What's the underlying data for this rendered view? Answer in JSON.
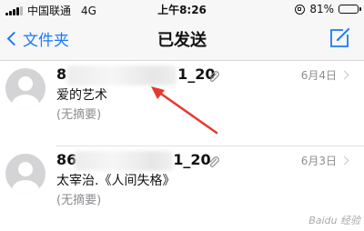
{
  "status_bar": {
    "carrier": "中国联通",
    "network": "4G",
    "time": "上午8:26",
    "battery_percent": "81%",
    "battery_level": 0.81
  },
  "nav": {
    "back_label": "文件夹",
    "title": "已发送"
  },
  "mails": [
    {
      "sender_visible": "8",
      "sender_suffix": "1_20",
      "date": "6月4日",
      "subject": "爱的艺术",
      "preview": "(无摘要)"
    },
    {
      "sender_visible": "86",
      "sender_suffix": "1_20",
      "date": "6月3日",
      "subject": "太宰治.《人间失格》",
      "preview": "(无摘要)"
    }
  ],
  "colors": {
    "accent": "#1a7af8",
    "arrow": "#e8382d"
  },
  "icons": [
    "signal-icon",
    "lock-rotation-icon",
    "battery-icon",
    "chevron-left-icon",
    "compose-icon",
    "avatar-icon",
    "paperclip-icon",
    "chevron-right-icon"
  ]
}
